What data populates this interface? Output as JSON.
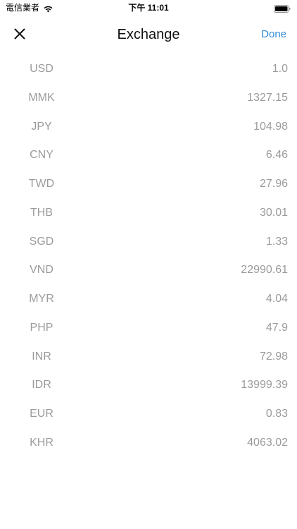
{
  "status_bar": {
    "carrier": "電信業者",
    "time": "下午 11:01",
    "wifi_icon": "wifi-icon",
    "battery_icon": "battery-icon"
  },
  "nav": {
    "title": "Exchange",
    "done_label": "Done",
    "close_icon": "close-icon",
    "accent_color": "#2f8bd6"
  },
  "rates": [
    {
      "code": "USD",
      "value": "1.0"
    },
    {
      "code": "MMK",
      "value": "1327.15"
    },
    {
      "code": "JPY",
      "value": "104.98"
    },
    {
      "code": "CNY",
      "value": "6.46"
    },
    {
      "code": "TWD",
      "value": "27.96"
    },
    {
      "code": "THB",
      "value": "30.01"
    },
    {
      "code": "SGD",
      "value": "1.33"
    },
    {
      "code": "VND",
      "value": "22990.61"
    },
    {
      "code": "MYR",
      "value": "4.04"
    },
    {
      "code": "PHP",
      "value": "47.9"
    },
    {
      "code": "INR",
      "value": "72.98"
    },
    {
      "code": "IDR",
      "value": "13999.39"
    },
    {
      "code": "EUR",
      "value": "0.83"
    },
    {
      "code": "KHR",
      "value": "4063.02"
    }
  ]
}
